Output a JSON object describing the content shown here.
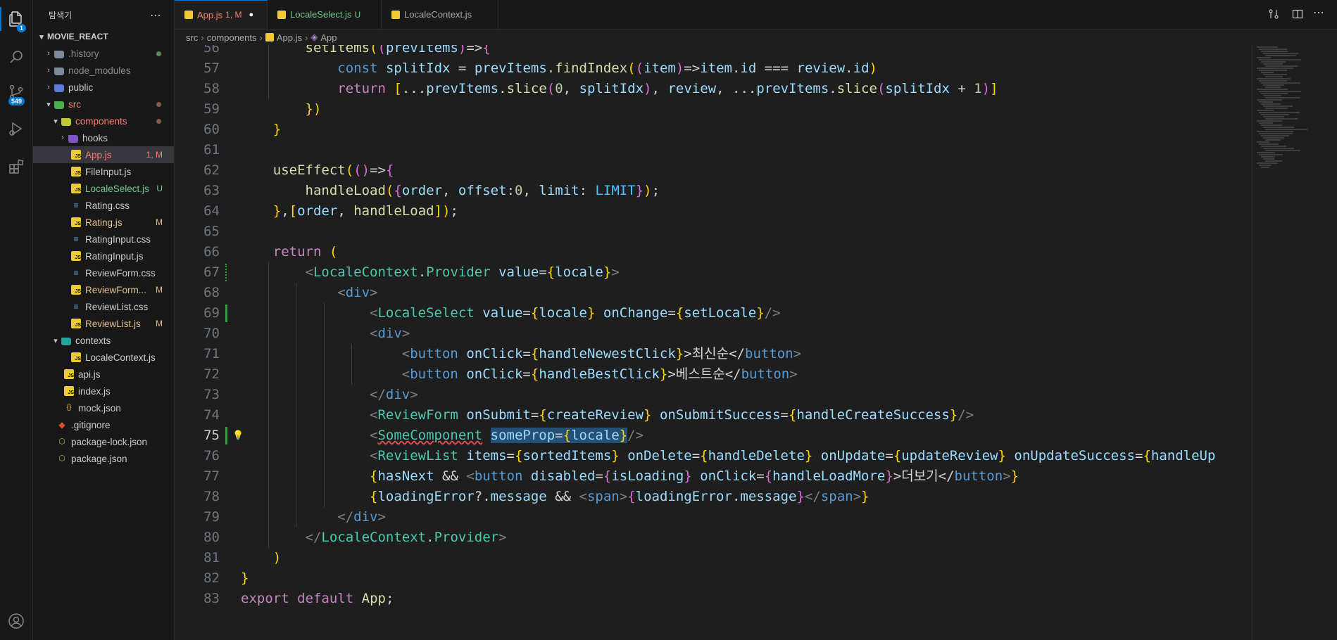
{
  "activity_bar": {
    "explorer_badge": "1",
    "scm_badge": "549",
    "icons": [
      "files-icon",
      "search-icon",
      "source-control-icon",
      "run-debug-icon",
      "extensions-icon",
      "account-icon"
    ]
  },
  "sidebar": {
    "title": "탐색기",
    "more_label": "⋯",
    "root": "MOVIE_REACT",
    "items": [
      {
        "label": ".history",
        "status": ""
      },
      {
        "label": "node_modules",
        "status": ""
      },
      {
        "label": "public",
        "status": ""
      },
      {
        "label": "src",
        "status": ""
      },
      {
        "label": "components",
        "status": ""
      },
      {
        "label": "hooks",
        "status": ""
      },
      {
        "label": "App.js",
        "status": "1, M"
      },
      {
        "label": "FileInput.js",
        "status": ""
      },
      {
        "label": "LocaleSelect.js",
        "status": "U"
      },
      {
        "label": "Rating.css",
        "status": ""
      },
      {
        "label": "Rating.js",
        "status": "M"
      },
      {
        "label": "RatingInput.css",
        "status": ""
      },
      {
        "label": "RatingInput.js",
        "status": ""
      },
      {
        "label": "ReviewForm.css",
        "status": ""
      },
      {
        "label": "ReviewForm...",
        "status": "M"
      },
      {
        "label": "ReviewList.css",
        "status": ""
      },
      {
        "label": "ReviewList.js",
        "status": "M"
      },
      {
        "label": "contexts",
        "status": ""
      },
      {
        "label": "LocaleContext.js",
        "status": ""
      },
      {
        "label": "api.js",
        "status": ""
      },
      {
        "label": "index.js",
        "status": ""
      },
      {
        "label": "mock.json",
        "status": ""
      },
      {
        "label": ".gitignore",
        "status": ""
      },
      {
        "label": "package-lock.json",
        "status": ""
      },
      {
        "label": "package.json",
        "status": ""
      }
    ]
  },
  "tabs": [
    {
      "label": "App.js",
      "status": "1, M",
      "modified_dot": "●"
    },
    {
      "label": "LocaleSelect.js",
      "status": "U"
    },
    {
      "label": "LocaleContext.js",
      "status": ""
    }
  ],
  "breadcrumb": [
    "src",
    "components",
    "App.js",
    "App"
  ],
  "code": {
    "current_line": "75",
    "line_numbers": [
      "56",
      "57",
      "58",
      "59",
      "60",
      "61",
      "62",
      "63",
      "64",
      "65",
      "66",
      "67",
      "68",
      "69",
      "70",
      "71",
      "72",
      "73",
      "74",
      "75",
      "76",
      "77",
      "78",
      "79",
      "80",
      "81",
      "82",
      "83"
    ],
    "lines": [
      "        setItems((prevItems)=>{",
      "            const splitIdx = prevItems.findIndex((item)=>item.id === review.id)",
      "            return [...prevItems.slice(0, splitIdx), review, ...prevItems.slice(splitIdx + 1)]",
      "        })",
      "    }",
      "",
      "    useEffect(()=>{",
      "        handleLoad({order, offset:0, limit: LIMIT});",
      "    },[order, handleLoad]);",
      "",
      "    return (",
      "        <LocaleContext.Provider value={locale}>",
      "            <div>",
      "                <LocaleSelect value={locale} onChange={setLocale}/>",
      "                <div>",
      "                    <button onClick={handleNewestClick}>최신순</button>",
      "                    <button onClick={handleBestClick}>베스트순</button>",
      "                </div>",
      "                <ReviewForm onSubmit={createReview} onSubmitSuccess={handleCreateSuccess}/>",
      "                <SomeComponent someProp={locale}/>",
      "                <ReviewList items={sortedItems} onDelete={handleDelete} onUpdate={updateReview} onUpdateSuccess={handleUp",
      "                {hasNext && <button disabled={isLoading} onClick={handleLoadMore}>더보기</button>}",
      "                {loadingError?.message && <span>{loadingError.message}</span>}",
      "            </div>",
      "        </LocaleContext.Provider>",
      "    )",
      "}",
      "export default App;"
    ]
  },
  "colors": {
    "accent": "#0078d4",
    "modified": "#e2c08d",
    "untracked": "#73c991",
    "error": "#f88070"
  }
}
